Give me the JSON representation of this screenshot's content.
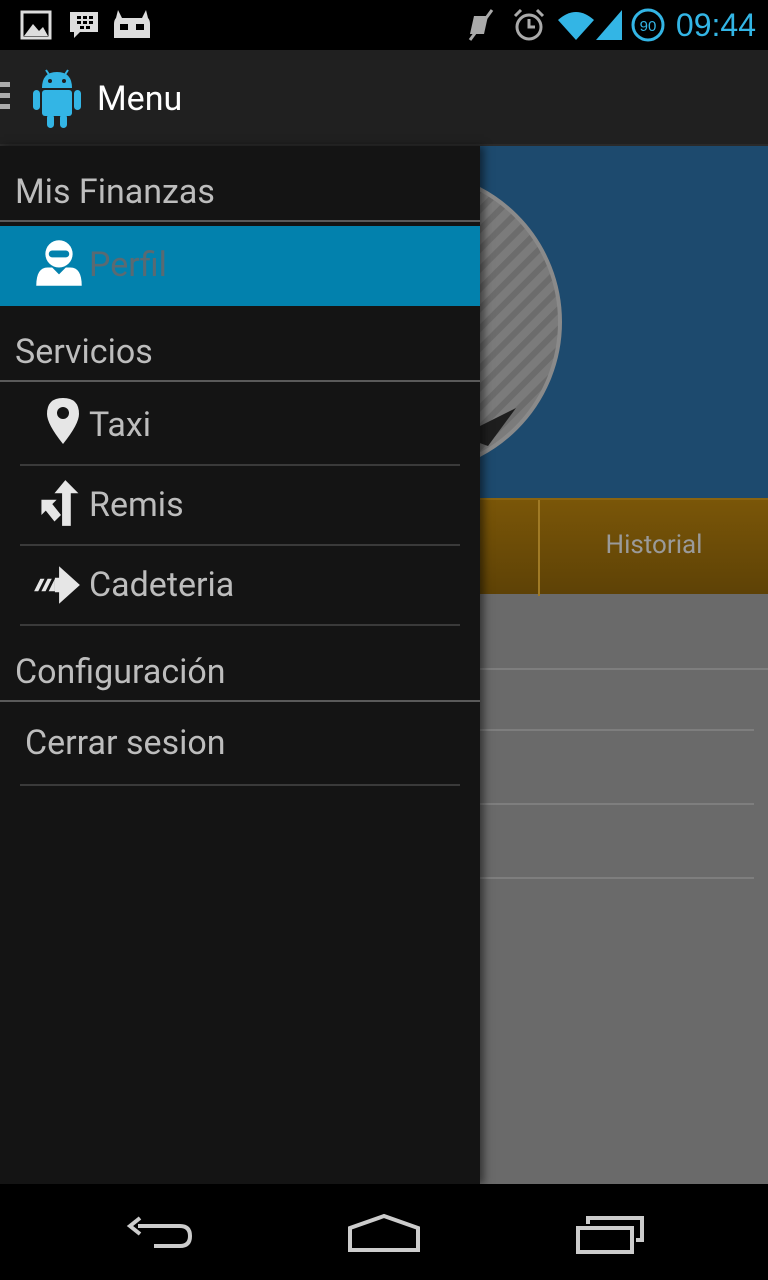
{
  "status_bar": {
    "time": "09:44",
    "icons": [
      "gallery-icon",
      "bbm-icon",
      "cyanogenmod-icon",
      "mute-icon",
      "alarm-icon",
      "wifi-icon",
      "signal-icon",
      "battery-icon"
    ],
    "battery_level": "90",
    "accent_color": "#33b5e5"
  },
  "action_bar": {
    "title": "Menu",
    "icon": "android-icon"
  },
  "drawer": {
    "sections": [
      {
        "header": "Mis Finanzas",
        "items": [
          {
            "label": "Perfil",
            "icon": "person-icon",
            "selected": true
          }
        ]
      },
      {
        "header": "Servicios",
        "items": [
          {
            "label": "Taxi",
            "icon": "map-pin-icon"
          },
          {
            "label": "Remis",
            "icon": "turn-arrow-icon"
          },
          {
            "label": "Cadeteria",
            "icon": "fast-arrow-icon"
          }
        ]
      },
      {
        "header": "Configuración",
        "items": [
          {
            "label": "Cerrar sesion"
          }
        ]
      }
    ],
    "selected_color": "#0281ad"
  },
  "background_content": {
    "tab_label": "Historial"
  },
  "navigation_bar": {
    "buttons": [
      "back-icon",
      "home-icon",
      "recents-icon"
    ]
  }
}
